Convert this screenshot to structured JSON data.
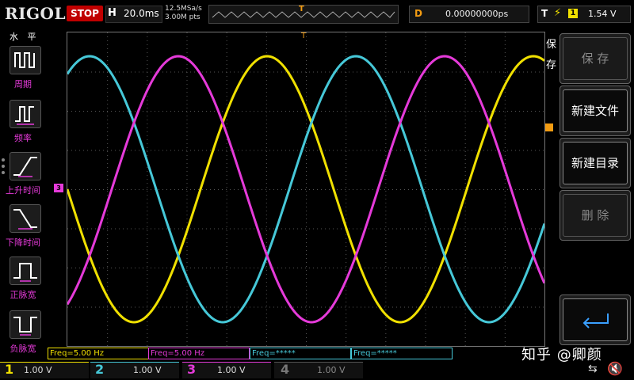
{
  "header": {
    "logo": "RIGOL",
    "run_state": "STOP",
    "timebase_label": "H",
    "timebase_value": "20.0ms",
    "sample_rate": "12.5MSa/s",
    "memory_depth": "3.00M pts",
    "trigger_pos_marker": "T",
    "delay_label": "D",
    "delay_value": "0.00000000ps",
    "trigger_label": "T",
    "trigger_source": "1",
    "trigger_level": "1.54 V"
  },
  "left_panel": {
    "title": "水 平",
    "items": [
      {
        "label": "周期",
        "icon": "period-icon"
      },
      {
        "label": "频率",
        "icon": "frequency-icon"
      },
      {
        "label": "上升时间",
        "icon": "rise-time-icon"
      },
      {
        "label": "下降时间",
        "icon": "fall-time-icon"
      },
      {
        "label": "正脉宽",
        "icon": "positive-width-icon"
      },
      {
        "label": "负脉宽",
        "icon": "negative-width-icon"
      }
    ]
  },
  "right_menu": {
    "title": "保存",
    "buttons": [
      {
        "label": "保 存",
        "enabled": false
      },
      {
        "label": "新建文件",
        "enabled": true
      },
      {
        "label": "新建目录",
        "enabled": true
      },
      {
        "label": "删 除",
        "enabled": false
      },
      {
        "label": "",
        "icon": "enter-icon",
        "enabled": true
      }
    ]
  },
  "freq_readouts": [
    {
      "text": "Freq=5.00 Hz",
      "color": "#f0e000"
    },
    {
      "text": "Freq=5.00 Hz",
      "color": "#e53ad9"
    },
    {
      "text": "Freq=*****",
      "color": "#46c8d8"
    },
    {
      "text": "Freq=*****",
      "color": "#46c8d8"
    }
  ],
  "channels": [
    {
      "number": "1",
      "scale": "1.00 V",
      "color": "#f0e000"
    },
    {
      "number": "2",
      "scale": "1.00 V",
      "color": "#46c8d8"
    },
    {
      "number": "3",
      "scale": "1.00 V",
      "color": "#e53ad9"
    },
    {
      "number": "4",
      "scale": "1.00 V",
      "color": "#777777"
    }
  ],
  "channel3_marker": "3",
  "watermark": "知乎 @卿颜",
  "colors": {
    "ch1": "#f0e000",
    "ch2": "#46c8d8",
    "ch3": "#e53ad9",
    "stop": "#c00000",
    "accent": "#f39c12"
  }
}
